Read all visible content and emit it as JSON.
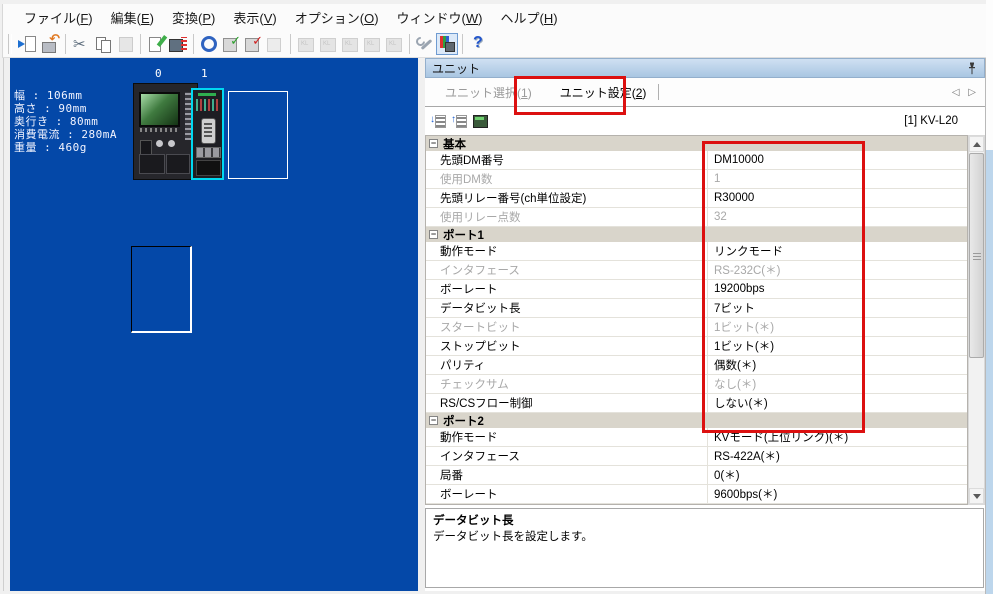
{
  "menu": {
    "items": [
      "ファイル(F)",
      "編集(E)",
      "変換(P)",
      "表示(V)",
      "オプション(O)",
      "ウィンドウ(W)",
      "ヘルプ(H)"
    ]
  },
  "toolbar": {
    "icons": [
      {
        "name": "import-project"
      },
      {
        "name": "transfer-device"
      },
      {
        "sep": true
      },
      {
        "name": "cut"
      },
      {
        "name": "copy"
      },
      {
        "name": "paste",
        "disabled": true
      },
      {
        "sep": true
      },
      {
        "name": "edit-doc"
      },
      {
        "name": "device-flash"
      },
      {
        "sep": true
      },
      {
        "name": "dmrly-sync"
      },
      {
        "name": "dmrly-check-green"
      },
      {
        "name": "dmrly-check-red"
      },
      {
        "name": "unit-gray",
        "disabled": true
      },
      {
        "sep": true
      },
      {
        "name": "kl-unit-1",
        "disabled": true
      },
      {
        "name": "kl-unit-2",
        "disabled": true
      },
      {
        "name": "kl-unit-3",
        "disabled": true
      },
      {
        "name": "kl-unit-4",
        "disabled": true
      },
      {
        "name": "kl-unit-5",
        "disabled": true
      },
      {
        "sep": true
      },
      {
        "name": "wrench"
      },
      {
        "name": "unit-editor",
        "active": true
      },
      {
        "sep": true
      },
      {
        "name": "help"
      }
    ]
  },
  "canvas": {
    "specs": [
      "幅 : 106mm",
      "高さ : 90mm",
      "奥行き : 80mm",
      "消費電流 : 280mA",
      "重量 : 460g"
    ],
    "slot_labels": [
      "0",
      "1"
    ]
  },
  "panel": {
    "title": "ユニット",
    "tabs": [
      {
        "label": "ユニット選択(1)",
        "active": false
      },
      {
        "label": "ユニット設定(2)",
        "active": true
      }
    ],
    "nav_arrows": "◁ ▷",
    "mini_toolbar": [
      {
        "name": "expand-all"
      },
      {
        "name": "collapse-all"
      },
      {
        "name": "write-unit"
      }
    ],
    "selected_unit": "[1] KV-L20",
    "settings": {
      "groups": [
        {
          "name": "基本",
          "rows": [
            {
              "label": "先頭DM番号",
              "value": "DM10000",
              "dim": false
            },
            {
              "label": "使用DM数",
              "value": "1",
              "dim": true
            },
            {
              "label": "先頭リレー番号(ch単位設定)",
              "value": "R30000",
              "dim": false
            },
            {
              "label": "使用リレー点数",
              "value": "32",
              "dim": true
            }
          ]
        },
        {
          "name": "ポート1",
          "rows": [
            {
              "label": "動作モード",
              "value": "リンクモード",
              "dim": false
            },
            {
              "label": "インタフェース",
              "value": "RS-232C(＊)",
              "dim": true
            },
            {
              "label": "ボーレート",
              "value": "19200bps",
              "dim": false
            },
            {
              "label": "データビット長",
              "value": "7ビット",
              "dim": false
            },
            {
              "label": "スタートビット",
              "value": "1ビット(＊)",
              "dim": true
            },
            {
              "label": "ストップビット",
              "value": "1ビット(＊)",
              "dim": false
            },
            {
              "label": "パリティ",
              "value": "偶数(＊)",
              "dim": false
            },
            {
              "label": "チェックサム",
              "value": "なし(＊)",
              "dim": true
            },
            {
              "label": "RS/CSフロー制御",
              "value": "しない(＊)",
              "dim": false
            }
          ]
        },
        {
          "name": "ポート2",
          "rows": [
            {
              "label": "動作モード",
              "value": "KVモード(上位リンク)(＊)",
              "dim": false
            },
            {
              "label": "インタフェース",
              "value": "RS-422A(＊)",
              "dim": false
            },
            {
              "label": "局番",
              "value": "0(＊)",
              "dim": false
            },
            {
              "label": "ボーレート",
              "value": "9600bps(＊)",
              "dim": false
            }
          ]
        }
      ]
    },
    "description": {
      "title": "データビット長",
      "text": "データビット長を設定します。"
    }
  },
  "colors": {
    "canvas_blue": "#0448a8",
    "annotation_red": "#dc1010",
    "selection_cyan": "#00d8f0",
    "group_header_bg": "#d9d5cb"
  }
}
